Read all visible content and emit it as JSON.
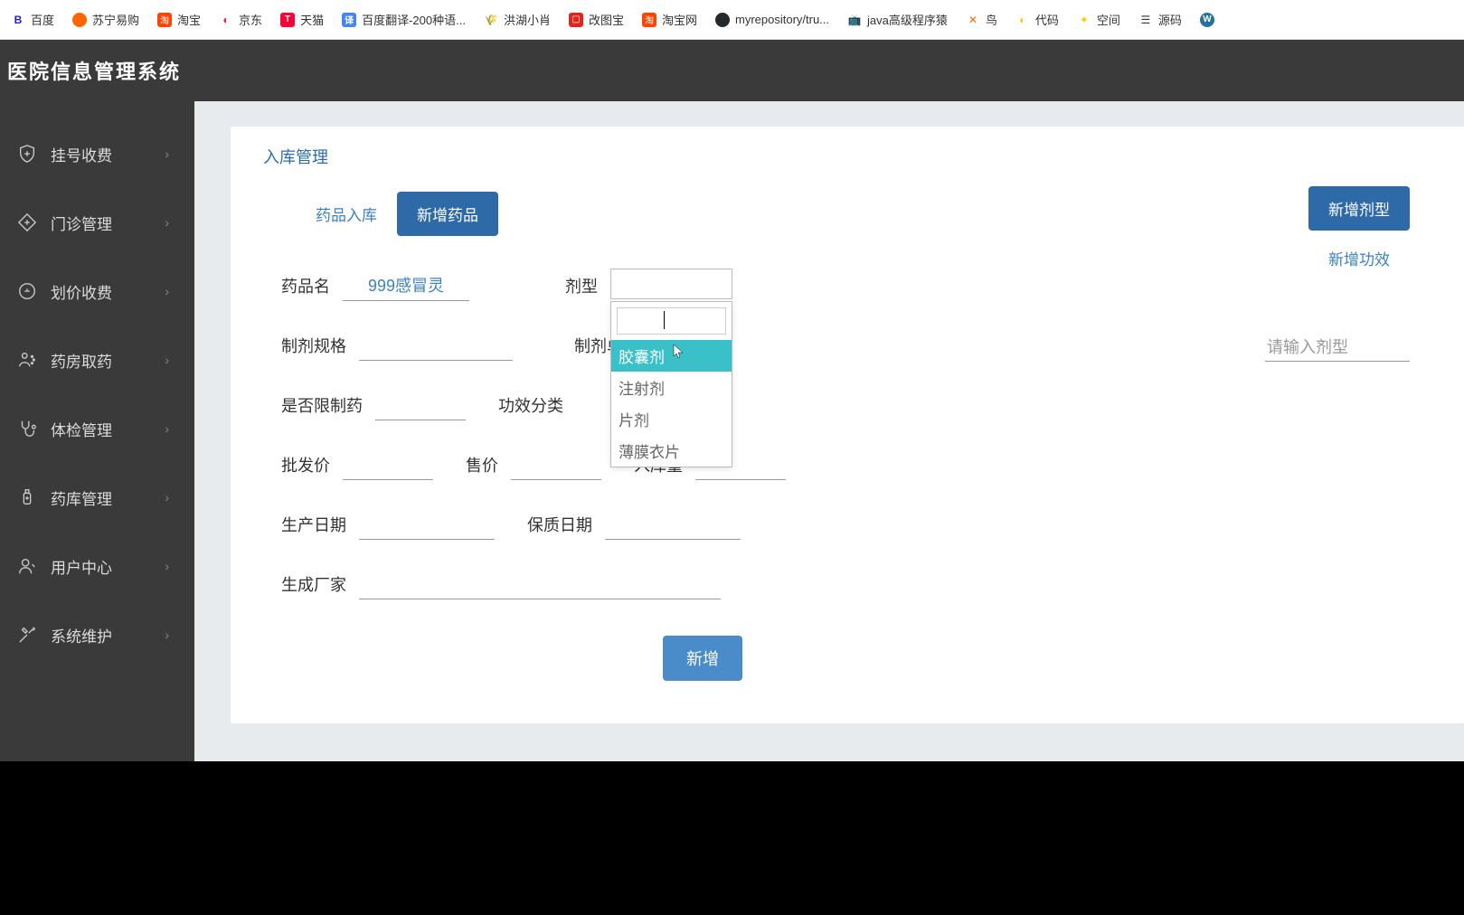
{
  "bookmarks": [
    {
      "label": "百度"
    },
    {
      "label": "苏宁易购"
    },
    {
      "label": "淘宝"
    },
    {
      "label": "京东"
    },
    {
      "label": "天猫"
    },
    {
      "label": "百度翻译-200种语..."
    },
    {
      "label": "洪湖小肖"
    },
    {
      "label": "改图宝"
    },
    {
      "label": "淘宝网"
    },
    {
      "label": "myrepository/tru..."
    },
    {
      "label": "java高级程序猿"
    },
    {
      "label": "鸟"
    },
    {
      "label": "代码"
    },
    {
      "label": "空间"
    },
    {
      "label": "源码"
    }
  ],
  "header": {
    "title": "医院信息管理系统"
  },
  "sidebar": {
    "items": [
      {
        "label": "挂号收费"
      },
      {
        "label": "门诊管理"
      },
      {
        "label": "划价收费"
      },
      {
        "label": "药房取药"
      },
      {
        "label": "体检管理"
      },
      {
        "label": "药库管理"
      },
      {
        "label": "用户中心"
      },
      {
        "label": "系统维护"
      }
    ]
  },
  "panel": {
    "title": "入库管理",
    "tabs": [
      {
        "label": "药品入库",
        "active": false
      },
      {
        "label": "新增药品",
        "active": true
      }
    ],
    "right_actions": {
      "btn": "新增剂型",
      "link": "新增功效"
    },
    "right_input_placeholder": "请输入剂型"
  },
  "form": {
    "labels": {
      "drug_name": "药品名",
      "dosage_form": "剂型",
      "spec": "制剂规格",
      "unit": "制剂单位",
      "is_restricted": "是否限制药",
      "effect_category": "功效分类",
      "wholesale_price": "批发价",
      "sale_price": "售价",
      "stock_qty": "入库量",
      "production_date": "生产日期",
      "expiry_date": "保质日期",
      "manufacturer": "生成厂家"
    },
    "values": {
      "drug_name": "999感冒灵"
    },
    "dropdown": {
      "options": [
        "胶囊剂",
        "注射剂",
        "片剂",
        "薄膜衣片"
      ],
      "highlighted_index": 0
    },
    "submit_label": "新增"
  }
}
